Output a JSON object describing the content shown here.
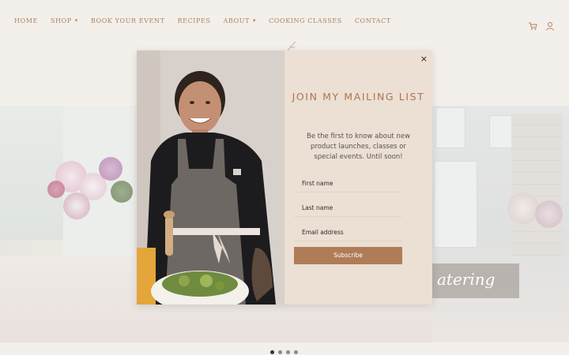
{
  "nav": {
    "items": [
      {
        "label": "HOME",
        "has_dropdown": false
      },
      {
        "label": "SHOP",
        "has_dropdown": true
      },
      {
        "label": "BOOK YOUR EVENT",
        "has_dropdown": false
      },
      {
        "label": "RECIPES",
        "has_dropdown": false
      },
      {
        "label": "ABOUT",
        "has_dropdown": true
      },
      {
        "label": "COOKING CLASSES",
        "has_dropdown": false
      },
      {
        "label": "CONTACT",
        "has_dropdown": false
      }
    ],
    "icons": [
      "cart-icon",
      "user-icon"
    ],
    "accent_color": "#b0825d"
  },
  "hero": {
    "caption": "atering",
    "slide_count": 4,
    "active_slide": 1
  },
  "modal": {
    "close_symbol": "×",
    "title": "JOIN MY MAILING LIST",
    "description": "Be the first to know about new product launches, classes or special events. Until soon!",
    "fields": [
      {
        "name": "first-name",
        "placeholder": "First name"
      },
      {
        "name": "last-name",
        "placeholder": "Last name"
      },
      {
        "name": "email",
        "placeholder": "Email address"
      }
    ],
    "submit_label": "Subscribe",
    "button_color": "#b07c58",
    "panel_color": "#ecdfd3"
  }
}
